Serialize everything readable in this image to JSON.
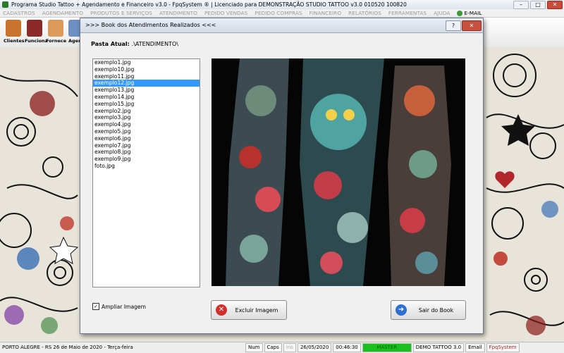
{
  "window": {
    "title": "Programa Studio Tattoo + Agendamento e Financeiro v3.0 - FpqSystem ® | Licenciado para  DEMONSTRAÇÃO STUDIO TATTOO v3.0 010520 100820",
    "min": "–",
    "max": "□",
    "close": "✕"
  },
  "menu": [
    "CADASTROS",
    "AGENDAMENTO",
    "PRODUTOS E SERVIÇOS",
    "ATENDIMENTO",
    "PEDIDO VENDAS",
    "PEDIDO COMPRAS",
    "FINANCEIRO",
    "RELATÓRIOS",
    "FERRAMENTAS",
    "AJUDA"
  ],
  "menu_email": "E-MAIL",
  "toolbar": [
    {
      "label": "Clientes",
      "icon": "clients-icon",
      "color": "#c9742e"
    },
    {
      "label": "Funciona",
      "icon": "employees-icon",
      "color": "#8a2a2a"
    },
    {
      "label": "Fornece",
      "icon": "suppliers-icon",
      "color": "#d99a5a"
    },
    {
      "label": "Agen",
      "icon": "schedule-icon",
      "color": "#6d8fc4"
    }
  ],
  "dialog": {
    "title": ">>>  Book dos Atendimentos Realizados  <<<",
    "help": "?",
    "close": "✕",
    "folder_label": "Pasta Atual:",
    "folder_path": ".\\ATENDIMENTO\\",
    "files": [
      "exemplo1.jpg",
      "exemplo10.jpg",
      "exemplo11.jpg",
      "exemplo12.jpg",
      "exemplo13.jpg",
      "exemplo14.jpg",
      "exemplo15.jpg",
      "exemplo2.jpg",
      "exemplo3.jpg",
      "exemplo4.jpg",
      "exemplo5.jpg",
      "exemplo6.jpg",
      "exemplo7.jpg",
      "exemplo8.jpg",
      "exemplo9.jpg",
      "foto.jpg"
    ],
    "selected_file": "exemplo12.jpg",
    "zoom_checkbox": {
      "label": "Ampliar Imagem",
      "checked": true
    },
    "delete_button": "Excluir Imagem",
    "exit_button": "Sair do Book"
  },
  "status": {
    "location": "PORTO ALEGRE - RS 26 de Maio de 2020 - Terça-feira",
    "num": "Num",
    "caps": "Caps",
    "ins": "Ins",
    "date": "26/05/2020",
    "time": "00:46:30",
    "master": "MASTER",
    "edition": "DEMO TATTOO 3.0",
    "email": "Email",
    "brand": "FpqSystem"
  },
  "colors": {
    "selection": "#3399ff",
    "master": "#19c01e",
    "delete": "#d2302a",
    "exit": "#2f6fd1"
  }
}
